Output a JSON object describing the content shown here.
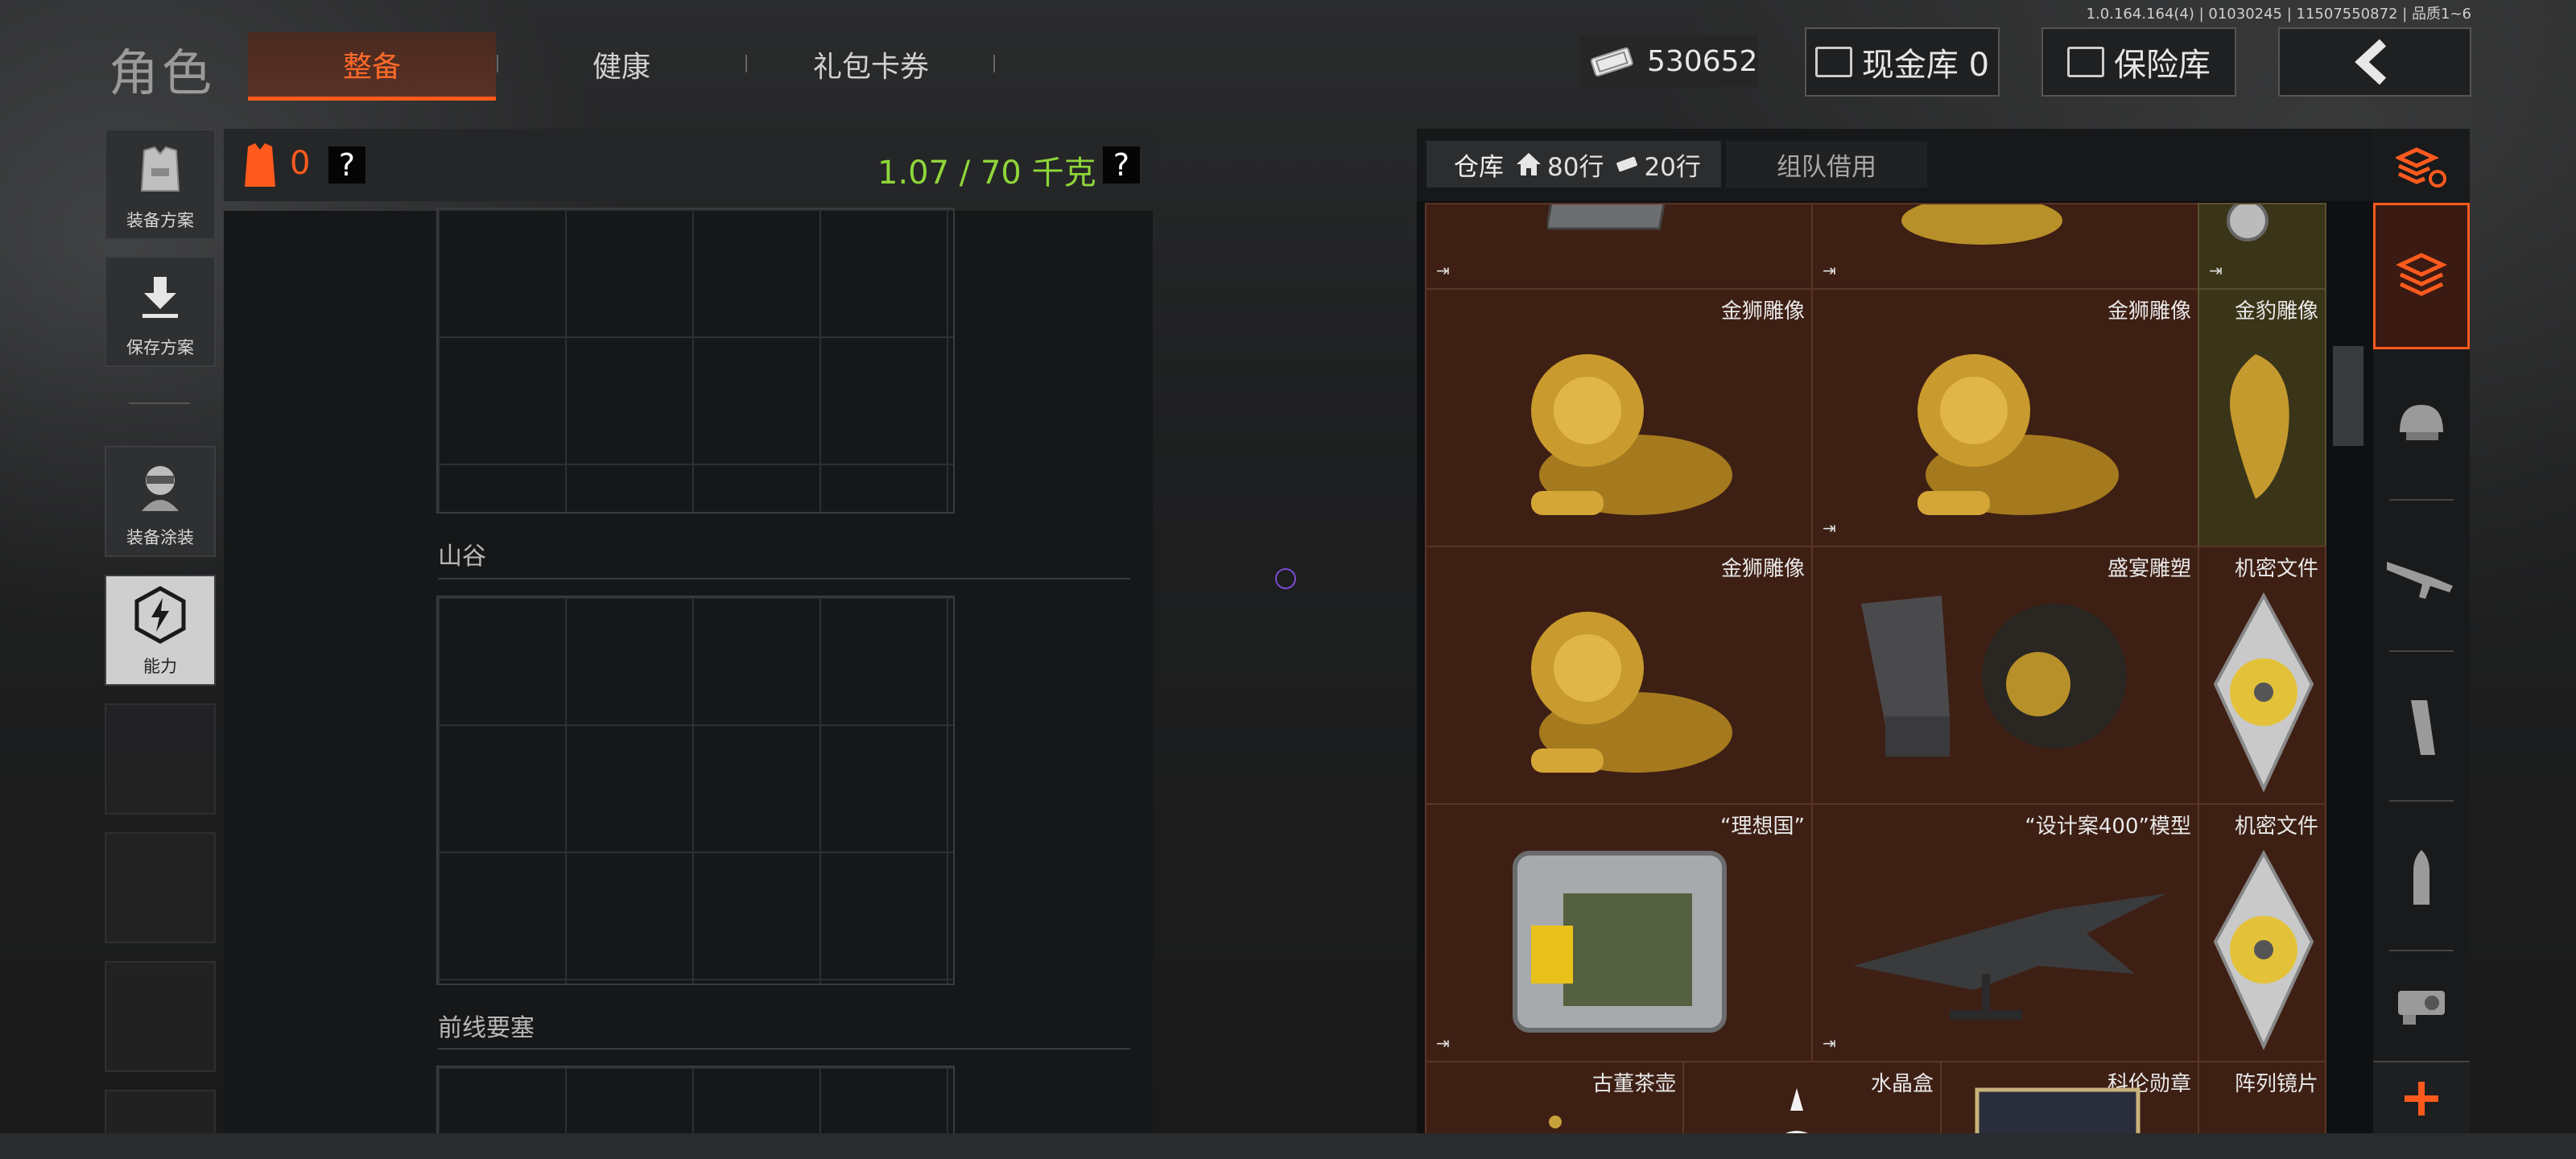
{
  "version": "1.0.164.164(4) | 01030245 | 11507550872 | 品质1~6",
  "header": {
    "title": "角色",
    "tabs": [
      {
        "label": "整备",
        "active": true
      },
      {
        "label": "健康"
      },
      {
        "label": "礼包卡券"
      }
    ],
    "money": "530652",
    "cash_vault": "现金库 0",
    "safe_vault": "保险库",
    "back_icon": "chevron-left-icon"
  },
  "sidebar": {
    "items": [
      {
        "label": "装备方案",
        "icon": "vest-icon"
      },
      {
        "label": "保存方案",
        "icon": "download-icon"
      },
      {
        "label": "装备涂装",
        "icon": "soldier-icon"
      },
      {
        "label": "能力",
        "icon": "ability-icon"
      }
    ]
  },
  "loadout": {
    "armor_count": "0",
    "help": "?",
    "weight": "1.07 / 70 千克",
    "sections": [
      {
        "title": "山谷"
      },
      {
        "title": "前线要塞"
      }
    ]
  },
  "warehouse": {
    "tab_label": "仓库",
    "home_rows": "80行",
    "ticket_rows": "20行",
    "team_tab": "组队借用",
    "items": [
      {
        "name": "金狮雕像",
        "col": 0,
        "row": 1
      },
      {
        "name": "金狮雕像",
        "col": 1,
        "row": 1
      },
      {
        "name": "金豹雕像",
        "col": 2,
        "row": 1
      },
      {
        "name": "金狮雕像",
        "col": 0,
        "row": 2
      },
      {
        "name": "盛宴雕塑",
        "col": 1,
        "row": 2
      },
      {
        "name": "机密文件",
        "col": 2,
        "row": 2
      },
      {
        "name": "“理想国”",
        "col": 0,
        "row": 3
      },
      {
        "name": "“设计案400”模型",
        "col": 1,
        "row": 3
      },
      {
        "name": "机密文件",
        "col": 2,
        "row": 3
      },
      {
        "name": "古董茶壶"
      },
      {
        "name": "水晶盒"
      },
      {
        "name": "科伦勋章"
      },
      {
        "name": "阵列镜片"
      }
    ],
    "exit_icon": "exit-icon"
  },
  "categories": [
    "stack-refresh-icon",
    "stack-icon",
    "helmet-icon",
    "rifle-icon",
    "magazine-icon",
    "ammo-icon",
    "scope-icon",
    "plus-icon"
  ],
  "colors": {
    "accent": "#ff5a1e",
    "weight_green": "#8fd63a",
    "gold_cell": "#3a3418",
    "brown_cell": "#3e1f14"
  }
}
